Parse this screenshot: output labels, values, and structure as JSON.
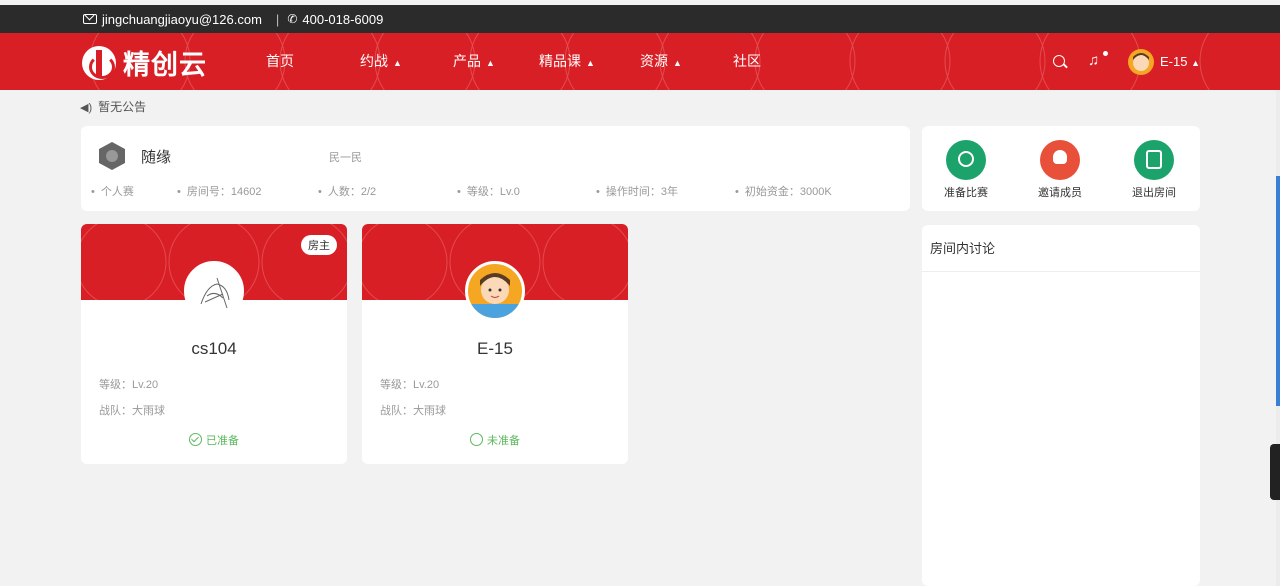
{
  "topbar": {
    "email": "jingchuangjiaoyu@126.com",
    "separator": "|",
    "phone": "400-018-6009"
  },
  "nav": {
    "logo_text": "精创云",
    "items": [
      {
        "label": "首页",
        "dropdown": ""
      },
      {
        "label": "约战",
        "dropdown": "▲"
      },
      {
        "label": "产品",
        "dropdown": "▲"
      },
      {
        "label": "精品课",
        "dropdown": "▲"
      },
      {
        "label": "资源",
        "dropdown": "▲"
      },
      {
        "label": "社区",
        "dropdown": ""
      }
    ],
    "user_name": "E-15",
    "user_caret": "▲"
  },
  "notice": "暂无公告",
  "room": {
    "name": "随缘",
    "mode": "民一民",
    "stats": [
      "个人赛",
      "房间号：14602",
      "人数：2/2",
      "等级：Lv.0",
      "操作时间：3年",
      "初始资金：3000K"
    ]
  },
  "actions": [
    {
      "label": "准备比赛",
      "color": "#1ba36b"
    },
    {
      "label": "邀请成员",
      "color": "#e8503a"
    },
    {
      "label": "退出房间",
      "color": "#1ba36b"
    }
  ],
  "players": [
    {
      "name": "cs104",
      "owner_badge": "房主",
      "level": "等级：Lv.20",
      "team": "战队：大雨球",
      "status": "已准备",
      "ready": true
    },
    {
      "name": "E-15",
      "owner_badge": "",
      "level": "等级：Lv.20",
      "team": "战队：大雨球",
      "status": "未准备",
      "ready": false
    }
  ],
  "discussion": {
    "title": "房间内讨论"
  },
  "colors": {
    "brand_red": "#d91f26",
    "topbar": "#2b2b2b",
    "ready_green": "#5cb85c"
  }
}
